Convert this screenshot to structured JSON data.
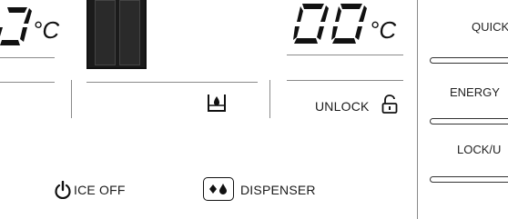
{
  "displays": {
    "left_temp": {
      "digits": "0",
      "unit": "°C"
    },
    "right_temp": {
      "digits": "00",
      "unit": "°C"
    }
  },
  "status": {
    "unlock_label": "UNLOCK"
  },
  "controls": {
    "ice_off_label": "ICE OFF",
    "dispenser_label": "DISPENSER"
  },
  "side_buttons": [
    {
      "label": "QUICK"
    },
    {
      "label": "ENERGY"
    },
    {
      "label": "LOCK/U"
    }
  ],
  "icons": {
    "power": "power-icon",
    "water_level": "water-glass-icon",
    "lock": "unlock-padlock-icon",
    "dispenser": "ice-water-drops-icon"
  }
}
